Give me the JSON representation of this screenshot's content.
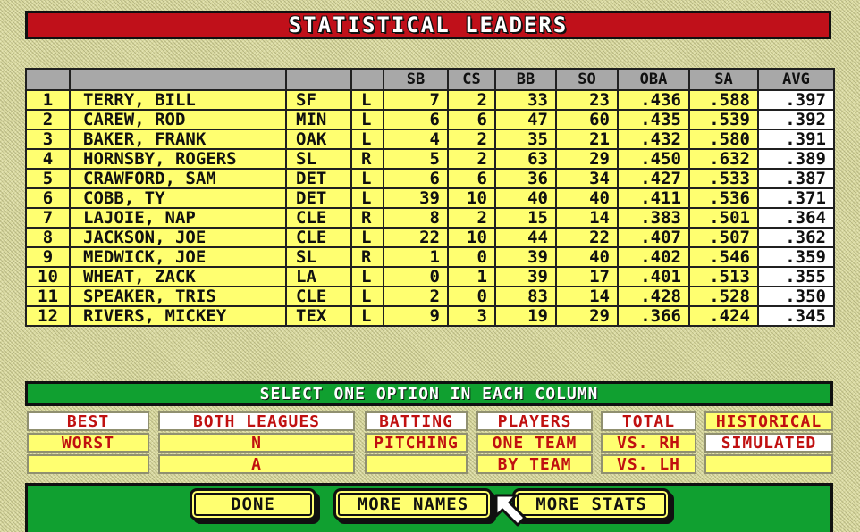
{
  "title": "STATISTICAL LEADERS",
  "table": {
    "headers": [
      "",
      "",
      "",
      "",
      "SB",
      "CS",
      "BB",
      "SO",
      "OBA",
      "SA",
      "AVG"
    ],
    "rows": [
      [
        "1",
        "TERRY, BILL",
        "SF",
        "L",
        "7",
        "2",
        "33",
        "23",
        ".436",
        ".588",
        ".397"
      ],
      [
        "2",
        "CAREW, ROD",
        "MIN",
        "L",
        "6",
        "6",
        "47",
        "60",
        ".435",
        ".539",
        ".392"
      ],
      [
        "3",
        "BAKER, FRANK",
        "OAK",
        "L",
        "4",
        "2",
        "35",
        "21",
        ".432",
        ".580",
        ".391"
      ],
      [
        "4",
        "HORNSBY, ROGERS",
        "SL",
        "R",
        "5",
        "2",
        "63",
        "29",
        ".450",
        ".632",
        ".389"
      ],
      [
        "5",
        "CRAWFORD, SAM",
        "DET",
        "L",
        "6",
        "6",
        "36",
        "34",
        ".427",
        ".533",
        ".387"
      ],
      [
        "6",
        "COBB, TY",
        "DET",
        "L",
        "39",
        "10",
        "40",
        "40",
        ".411",
        ".536",
        ".371"
      ],
      [
        "7",
        "LAJOIE, NAP",
        "CLE",
        "R",
        "8",
        "2",
        "15",
        "14",
        ".383",
        ".501",
        ".364"
      ],
      [
        "8",
        "JACKSON, JOE",
        "CLE",
        "L",
        "22",
        "10",
        "44",
        "22",
        ".407",
        ".507",
        ".362"
      ],
      [
        "9",
        "MEDWICK, JOE",
        "SL",
        "R",
        "1",
        "0",
        "39",
        "40",
        ".402",
        ".546",
        ".359"
      ],
      [
        "10",
        "WHEAT, ZACK",
        "LA",
        "L",
        "0",
        "1",
        "39",
        "17",
        ".401",
        ".513",
        ".355"
      ],
      [
        "11",
        "SPEAKER, TRIS",
        "CLE",
        "L",
        "2",
        "0",
        "83",
        "14",
        ".428",
        ".528",
        ".350"
      ],
      [
        "12",
        "RIVERS, MICKEY",
        "TEX",
        "L",
        "9",
        "3",
        "19",
        "29",
        ".366",
        ".424",
        ".345"
      ]
    ]
  },
  "select_header": "SELECT ONE OPTION IN EACH COLUMN",
  "options": {
    "best": "BEST",
    "worst": "WORST",
    "both_leagues": "BOTH LEAGUES",
    "league_n": "N",
    "league_a": "A",
    "batting": "BATTING",
    "pitching": "PITCHING",
    "players": "PLAYERS",
    "one_team": "ONE TEAM",
    "by_team": "BY TEAM",
    "total": "TOTAL",
    "vs_rh": "VS. RH",
    "vs_lh": "VS. LH",
    "historical": "HISTORICAL",
    "simulated": "SIMULATED"
  },
  "buttons": {
    "done": "DONE",
    "more_names": "MORE NAMES",
    "more_stats": "MORE STATS"
  },
  "icons": {
    "cursor": "arrow-cursor-icon"
  },
  "colors": {
    "title_red": "#c0101a",
    "panel_green": "#10a030",
    "row_yellow": "#ffff70",
    "option_red_text": "#c01010"
  }
}
